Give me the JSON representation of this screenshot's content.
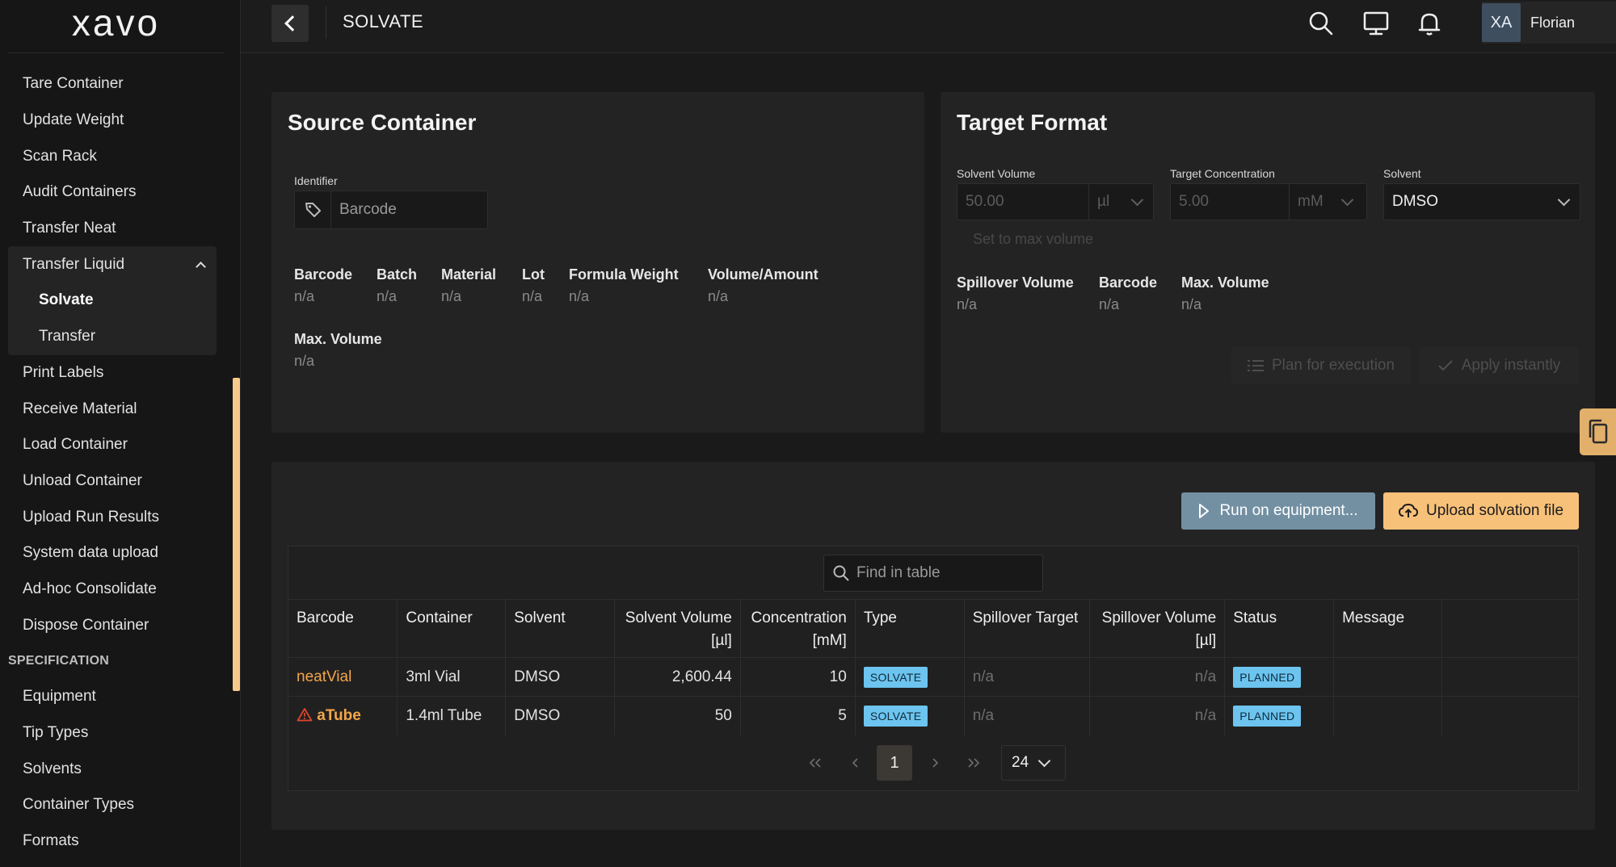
{
  "app": {
    "logo": "xavo",
    "page_title": "SOLVATE"
  },
  "user": {
    "initials": "XA",
    "name": "Florian"
  },
  "sidebar": {
    "items_top": [
      "Tare Container",
      "Update Weight",
      "Scan Rack",
      "Audit Containers",
      "Transfer Neat"
    ],
    "group": {
      "label": "Transfer Liquid",
      "children": [
        "Solvate",
        "Transfer"
      ]
    },
    "items_mid": [
      "Print Labels",
      "Receive Material",
      "Load Container",
      "Unload Container",
      "Upload Run Results",
      "System data upload",
      "Ad-hoc Consolidate",
      "Dispose Container"
    ],
    "section": "SPECIFICATION",
    "items_spec": [
      "Equipment",
      "Tip Types",
      "Solvents",
      "Container Types",
      "Formats"
    ]
  },
  "source": {
    "title": "Source Container",
    "identifier_label": "Identifier",
    "identifier_placeholder": "Barcode",
    "fields": [
      {
        "label": "Barcode",
        "value": "n/a"
      },
      {
        "label": "Batch",
        "value": "n/a"
      },
      {
        "label": "Material",
        "value": "n/a"
      },
      {
        "label": "Lot",
        "value": "n/a"
      },
      {
        "label": "Formula Weight",
        "value": "n/a"
      },
      {
        "label": "Volume/Amount",
        "value": "n/a"
      }
    ],
    "max_volume": {
      "label": "Max. Volume",
      "value": "n/a"
    }
  },
  "target": {
    "title": "Target Format",
    "solvent_volume": {
      "label": "Solvent Volume",
      "value": "50.00",
      "unit": "µl"
    },
    "target_concentration": {
      "label": "Target Concentration",
      "value": "5.00",
      "unit": "mM"
    },
    "solvent": {
      "label": "Solvent",
      "value": "DMSO"
    },
    "set_max": "Set to max volume",
    "fields": [
      {
        "label": "Spillover Volume",
        "value": "n/a"
      },
      {
        "label": "Barcode",
        "value": "n/a"
      },
      {
        "label": "Max. Volume",
        "value": "n/a"
      }
    ],
    "plan_btn": "Plan for execution",
    "apply_btn": "Apply instantly"
  },
  "actions": {
    "run": "Run on equipment...",
    "upload": "Upload solvation file"
  },
  "table": {
    "search_placeholder": "Find in table",
    "headers": [
      "Barcode",
      "Container",
      "Solvent",
      "Solvent Volume",
      "Concentration",
      "Type",
      "Spillover Target",
      "Spillover Volume",
      "Status",
      "Message"
    ],
    "header_units": {
      "solvent_volume": "[µl]",
      "concentration": "[mM]",
      "spillover_volume": "[µl]"
    },
    "rows": [
      {
        "barcode": "neatVial",
        "warning": false,
        "container": "3ml Vial",
        "solvent": "DMSO",
        "volume": "2,600.44",
        "concentration": "10",
        "type": "SOLVATE",
        "spill_target": "n/a",
        "spill_volume": "n/a",
        "status": "PLANNED",
        "message": ""
      },
      {
        "barcode": "aTube",
        "warning": true,
        "container": "1.4ml Tube",
        "solvent": "DMSO",
        "volume": "50",
        "concentration": "5",
        "type": "SOLVATE",
        "spill_target": "n/a",
        "spill_volume": "n/a",
        "status": "PLANNED",
        "message": ""
      }
    ],
    "pagination": {
      "current_page": "1",
      "per_page": "24"
    }
  },
  "colors": {
    "accent": "#f8c17a",
    "run_button": "#7390a3",
    "tag": "#6cc4ef",
    "link": "#f3a64a"
  }
}
